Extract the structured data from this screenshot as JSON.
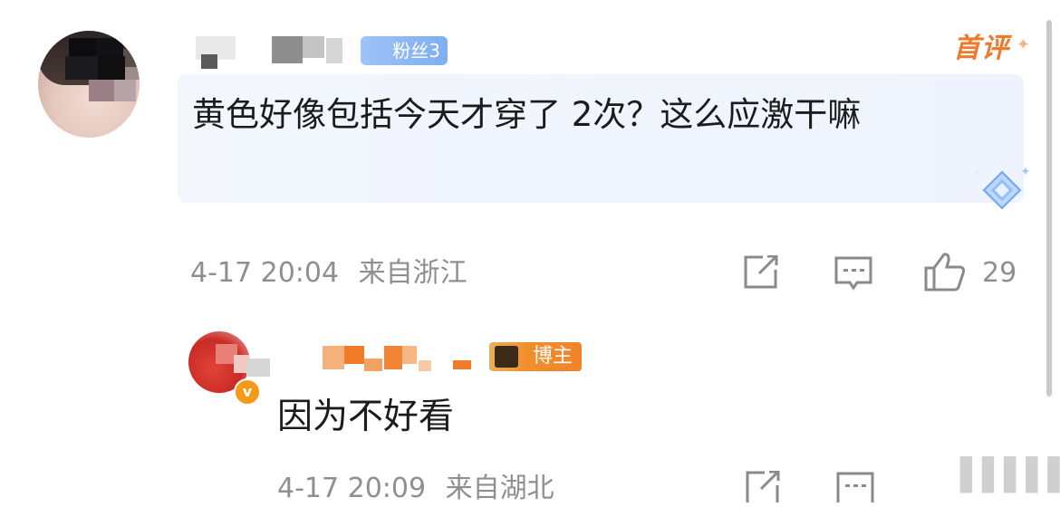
{
  "comment": {
    "fan_badge": "粉丝3",
    "first_badge": "首评",
    "text": "黄色好像包括今天才穿了 2次？这么应激干嘛",
    "date": "4-17 20:04",
    "location": "来自浙江",
    "like_count": "29"
  },
  "reply": {
    "blogger_badge": "博主",
    "text": "因为不好看",
    "date": "4-17 20:09",
    "location": "来自湖北"
  },
  "icons": {
    "share": "share-icon",
    "comment": "comment-icon",
    "like": "thumbs-up-icon",
    "verified": "verified-badge-icon",
    "diamond": "diamond-icon"
  },
  "colors": {
    "first_badge": "#f07a2c",
    "fan_badge": "#8ab5f4",
    "blogger_badge": "#f1832a",
    "bubble": "#f0f4fd",
    "meta_text": "#8f8f8f"
  }
}
